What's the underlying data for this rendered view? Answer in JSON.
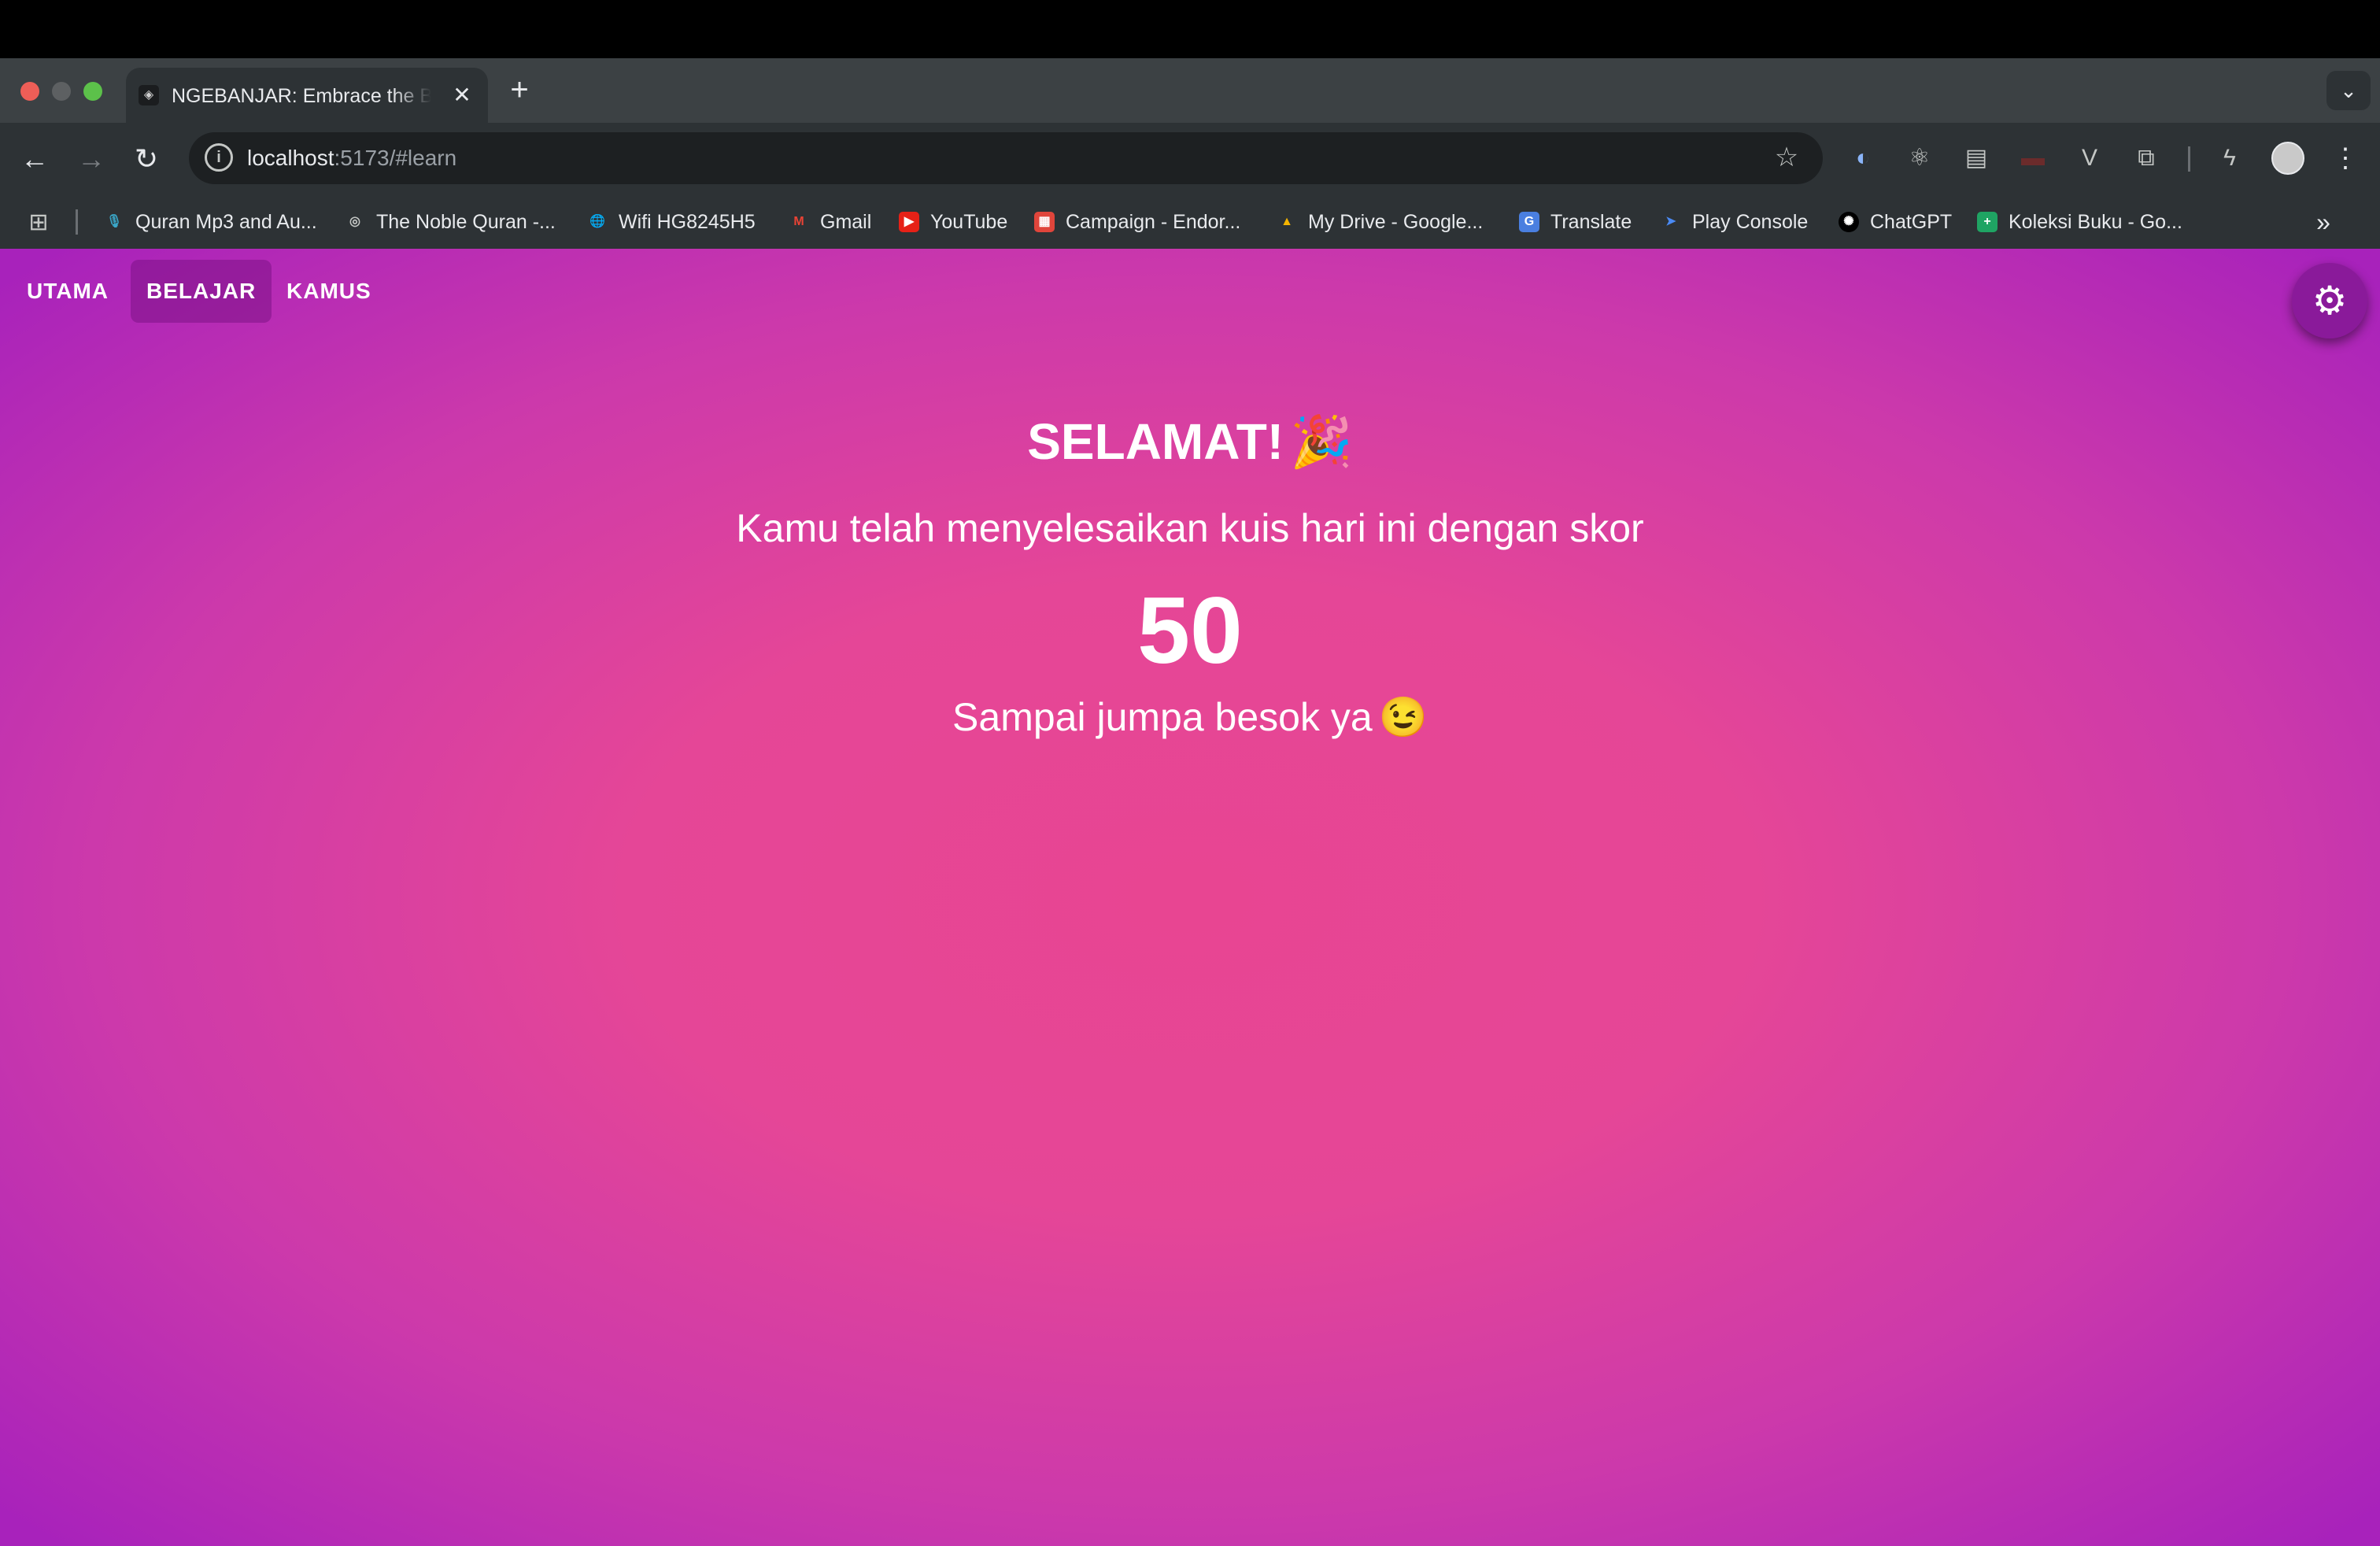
{
  "browser": {
    "tab": {
      "title": "NGEBANJAR: Embrace the Beauty of Banjar",
      "favicon": "app-icon",
      "close": "✕"
    },
    "new_tab": "+",
    "tab_search": "⌄",
    "nav": {
      "back": "←",
      "forward": "→",
      "reload": "↻"
    },
    "address": {
      "host": "localhost",
      "rest": ":5173/#learn",
      "info_icon": "i"
    },
    "star": "☆",
    "extensions": [
      {
        "name": "circle-extension-icon",
        "glyph": "◐"
      },
      {
        "name": "react-devtools-icon",
        "glyph": "⚛"
      },
      {
        "name": "screenshot-extension-icon",
        "glyph": "▤"
      },
      {
        "name": "red-extension-icon",
        "glyph": "▬"
      },
      {
        "name": "vue-devtools-icon",
        "glyph": "V"
      },
      {
        "name": "puzzle-icon",
        "glyph": "⧉"
      },
      {
        "name": "lightning-extension-icon",
        "glyph": "ϟ"
      }
    ],
    "menu": "⋮",
    "bookmarks_apps": "⊞",
    "bookmarks": [
      {
        "label": "Quran Mp3 and Au...",
        "icon": "microphone-icon",
        "color": "#3aa7c9",
        "glyph": "🎙"
      },
      {
        "label": "The Noble Quran -...",
        "icon": "quran-icon",
        "color": "#2d3235",
        "glyph": "◎"
      },
      {
        "label": "Wifi HG8245H5",
        "icon": "globe-icon",
        "color": "#2d3235",
        "glyph": "🌐"
      },
      {
        "label": "Gmail",
        "icon": "gmail-icon",
        "color": "#2d3235",
        "glyph": "M"
      },
      {
        "label": "YouTube",
        "icon": "youtube-icon",
        "color": "#e62117",
        "glyph": "▶"
      },
      {
        "label": "Campaign - Endor...",
        "icon": "campaign-icon",
        "color": "#e0453b",
        "glyph": "▦"
      },
      {
        "label": "My Drive - Google...",
        "icon": "drive-icon",
        "color": "#2d3235",
        "glyph": "▲"
      },
      {
        "label": "Translate",
        "icon": "translate-icon",
        "color": "#4a7fe0",
        "glyph": "G"
      },
      {
        "label": "Play Console",
        "icon": "play-console-icon",
        "color": "#2d3235",
        "glyph": "➤"
      },
      {
        "label": "ChatGPT",
        "icon": "chatgpt-icon",
        "color": "#000000",
        "glyph": "✺"
      },
      {
        "label": "Koleksi Buku - Go...",
        "icon": "sheets-icon",
        "color": "#1fa463",
        "glyph": "+"
      }
    ],
    "bookmarks_more": "»"
  },
  "app": {
    "nav": {
      "utama": "UTAMA",
      "belajar": "BELAJAR",
      "kamus": "KAMUS"
    },
    "settings_icon": "⚙",
    "result": {
      "title": "SELAMAT!",
      "title_emoji": "🎉",
      "message": "Kamu telah menyelesaikan kuis hari ini dengan skor",
      "score": "50",
      "farewell": "Sampai jumpa besok ya",
      "farewell_emoji": "😉"
    }
  }
}
